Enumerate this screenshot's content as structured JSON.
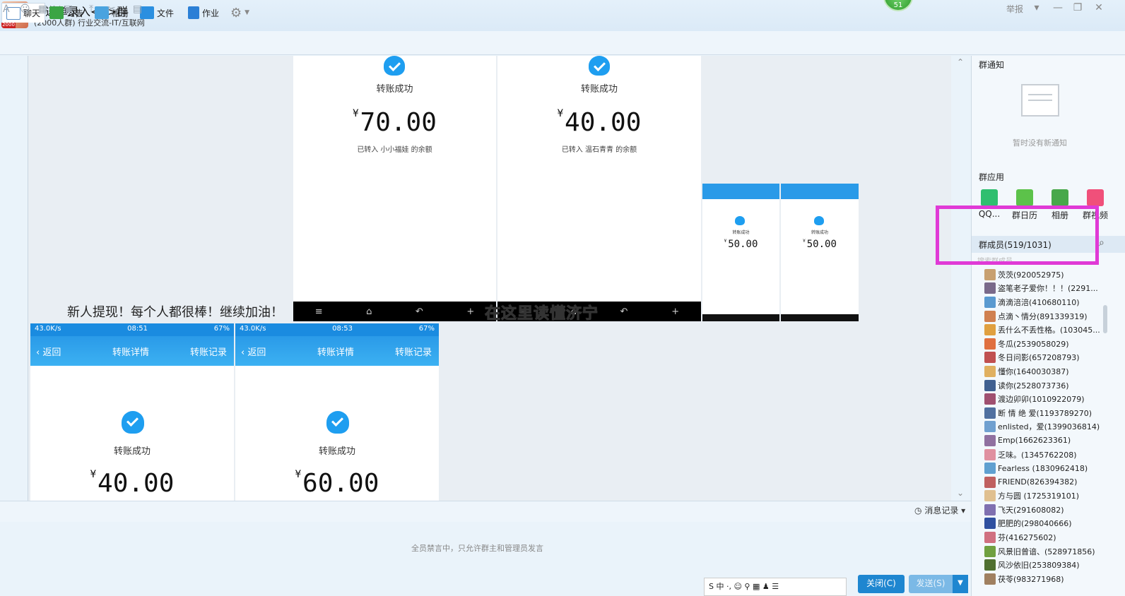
{
  "window": {
    "title": "快递单录入<6>群",
    "subtitle": "(2000人群) 行业交流-IT/互联网",
    "avatar_badge": "2000",
    "notif_count": "51",
    "report": "举报",
    "controls": [
      "▾",
      "—",
      "❐",
      "✕"
    ]
  },
  "toolbar": {
    "items": [
      {
        "label": "聊天",
        "icon": "chat-icon",
        "color": "#5b8fc7"
      },
      {
        "label": "公告",
        "icon": "flag-icon",
        "color": "#3aa544"
      },
      {
        "label": "相册",
        "icon": "photo-icon",
        "color": "#4aa3df"
      },
      {
        "label": "文件",
        "icon": "folder-icon",
        "color": "#2b8fe0"
      },
      {
        "label": "作业",
        "icon": "document-icon",
        "color": "#2b7fd6"
      }
    ],
    "settings_icon": "gear-icon"
  },
  "chat": {
    "message": "新人提现！每个人都很棒！继续加油！",
    "watermark": "在这里读懂济宁",
    "top_phones": [
      {
        "status": "转账成功",
        "amount": "70.00",
        "currency": "¥",
        "note": "已转入 小小福娃 的余额"
      },
      {
        "status": "转账成功",
        "amount": "40.00",
        "currency": "¥",
        "note": "已转入 温石青青 的余额"
      }
    ],
    "small_phones": [
      {
        "status": "转账成功",
        "amount": "50.00",
        "currency": "¥"
      },
      {
        "status": "转账成功",
        "amount": "50.00",
        "currency": "¥"
      }
    ],
    "bottom_phones": [
      {
        "speed": "43.0K/s",
        "time": "08:51",
        "battery": "67%",
        "back": "返回",
        "title": "转账详情",
        "right": "转账记录",
        "status": "转账成功",
        "amount": "40.00",
        "currency": "¥"
      },
      {
        "speed": "43.0K/s",
        "time": "08:53",
        "battery": "67%",
        "back": "返回",
        "title": "转账详情",
        "right": "转账记录",
        "status": "转账成功",
        "amount": "60.00",
        "currency": "¥"
      }
    ],
    "nav_icons": [
      "≡",
      "⌂",
      "↶",
      "+"
    ]
  },
  "input": {
    "tools": [
      "A",
      "☺",
      "▦",
      "▣",
      "⤒",
      "✂",
      "▤"
    ],
    "history": "消息记录",
    "banned_notice": "全员禁言中，只允许群主和管理员发言",
    "close": "关闭(C)",
    "send": "发送(S)",
    "ime": "S 中 ·, ☺ ⚲ ▦ ♟ ☰"
  },
  "sidebar": {
    "notice_title": "群通知",
    "notice_empty": "暂时没有新通知",
    "apps_title": "群应用",
    "apps": [
      {
        "label": "QQ...",
        "color": "#2fbf6f"
      },
      {
        "label": "群日历",
        "color": "#5cc24a"
      },
      {
        "label": "相册",
        "color": "#48a84a"
      },
      {
        "label": "群视频",
        "color": "#f0507a"
      }
    ],
    "members_title": "群成员(519/1031)",
    "members_sub": "搜索群成员",
    "members": [
      "茨茨(920052975)",
      "盗笔老子爱你！！！(2291...",
      "滴滴涪涪(410680110)",
      "点滴丶情分(891339319)",
      "丢什么不丢性格。(103045...",
      "冬瓜(2539058029)",
      "冬日问影(657208793)",
      "懂你(1640030387)",
      "读你(2528073736)",
      "渡边卯卯(1010922079)",
      "断 情 绝 爱(1193789270)",
      "enlisted，爱(1399036814)",
      "Emp(1662623361)",
      "    乏味。(1345762208)",
      "Fearless (1830962418)",
      "FRIEND(826394382)",
      "方与圆 (1725319101)",
      "飞天(291608082)",
      "肥肥的(298040666)",
      "芬(416275602)",
      "风景旧曾谙、(528971856)",
      "风沙依旧(253809384)",
      "茯苓(983271968)"
    ],
    "member_colors": [
      "#c8a070",
      "#7a6a8a",
      "#5a9ad0",
      "#d08050",
      "#e0a040",
      "#e07040",
      "#c05050",
      "#e0b060",
      "#406090",
      "#a05070",
      "#5070a0",
      "#70a0d0",
      "#9070a0",
      "#e090a0",
      "#60a0d0",
      "#c06060",
      "#e0c090",
      "#8070b0",
      "#3050a0",
      "#d07080",
      "#70a040",
      "#507030",
      "#a08060"
    ]
  }
}
